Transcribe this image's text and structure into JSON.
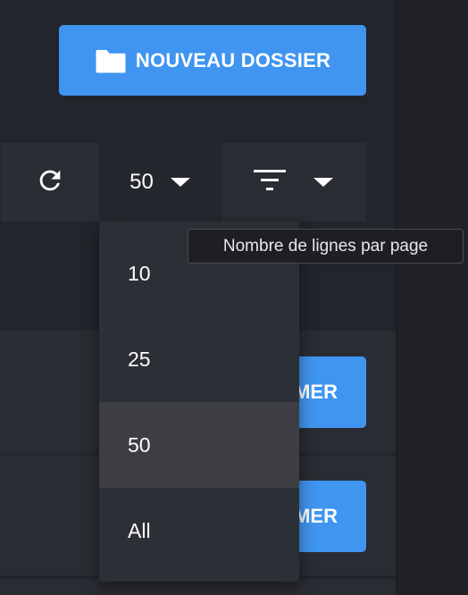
{
  "header": {
    "new_folder_label": "NOUVEAU DOSSIER",
    "new_folder_icon": "folder-icon"
  },
  "toolbar": {
    "refresh_icon": "refresh-icon",
    "rows_per_page_value": "50",
    "rows_caret_icon": "caret-down-icon",
    "filter_icon": "filter-icon",
    "filter_caret_icon": "caret-down-icon",
    "rows_tooltip": "Nombre de lignes par page"
  },
  "rows_menu": {
    "items": [
      {
        "label": "10",
        "selected": false
      },
      {
        "label": "25",
        "selected": false
      },
      {
        "label": "50",
        "selected": true
      },
      {
        "label": "All",
        "selected": false
      }
    ]
  },
  "rows": [
    {
      "action_label_visible": "MER"
    },
    {
      "action_label_visible": "MER"
    }
  ],
  "colors": {
    "accent": "#3f95f0",
    "background": "#23252c",
    "menu_background": "#2d2f36",
    "menu_selected": "#3c3e44"
  }
}
